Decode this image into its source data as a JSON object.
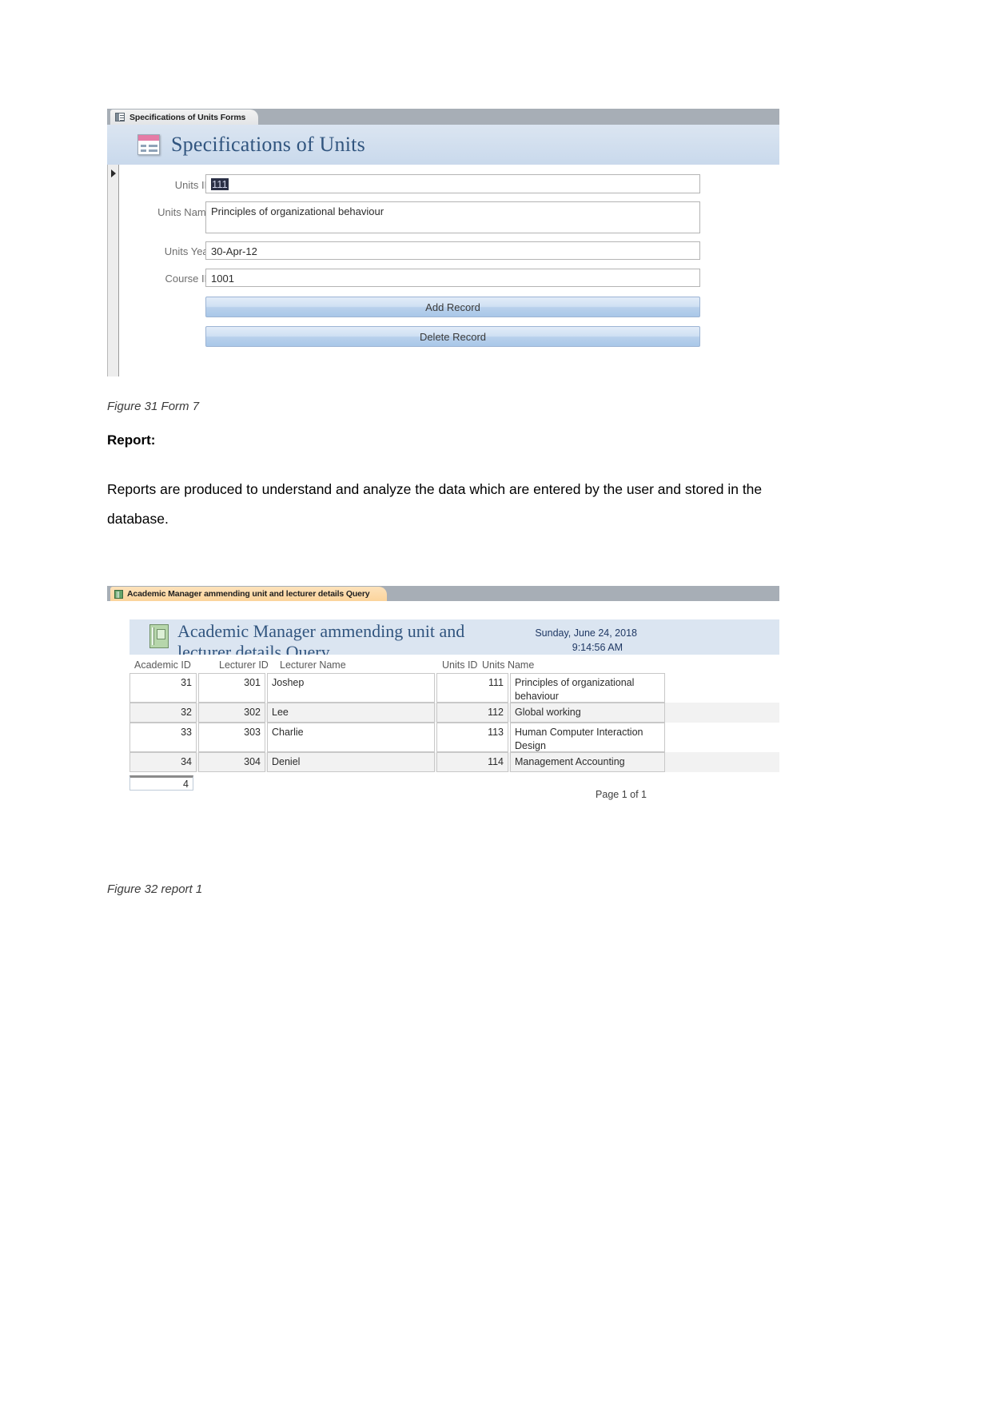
{
  "form_screenshot": {
    "tab": {
      "label": "Specifications of Units Forms",
      "icon": "form-icon"
    },
    "header": {
      "title": "Specifications of Units",
      "icon": "form-design-icon"
    },
    "fields": [
      {
        "label": "Units ID",
        "value": "111",
        "selected": true
      },
      {
        "label": "Units Name",
        "value": "Principles of organizational behaviour",
        "selected": false
      },
      {
        "label": "Units Year",
        "value": "30-Apr-12",
        "selected": false
      },
      {
        "label": "Course ID",
        "value": "1001",
        "selected": false
      }
    ],
    "buttons": [
      {
        "label": "Add Record"
      },
      {
        "label": "Delete Record"
      }
    ],
    "record_selector_icon": "record-selector-arrow-icon"
  },
  "figure_31_caption": "Figure 31 Form 7",
  "report_heading": "Report:",
  "report_paragraph": "Reports are produced to understand and analyze the data which are entered by the user and stored in the database.",
  "report_screenshot": {
    "tab": {
      "label": "Academic Manager ammending unit and lecturer details Query",
      "icon": "report-icon"
    },
    "header": {
      "title": "Academic Manager ammending unit and lecturer details Query",
      "date": "Sunday, June 24, 2018",
      "time": "9:14:56 AM",
      "icon": "report-book-icon"
    },
    "columns": [
      "Academic ID",
      "Lecturer ID",
      "Lecturer Name",
      "Units ID",
      "Units Name"
    ],
    "rows": [
      {
        "academic_id": "31",
        "lecturer_id": "301",
        "lecturer_name": "Joshep",
        "units_id": "111",
        "units_name": "Principles of organizational behaviour"
      },
      {
        "academic_id": "32",
        "lecturer_id": "302",
        "lecturer_name": "Lee",
        "units_id": "112",
        "units_name": "Global working"
      },
      {
        "academic_id": "33",
        "lecturer_id": "303",
        "lecturer_name": "Charlie",
        "units_id": "113",
        "units_name": "Human Computer Interaction Design"
      },
      {
        "academic_id": "34",
        "lecturer_id": "304",
        "lecturer_name": "Deniel",
        "units_id": "114",
        "units_name": "Management Accounting"
      }
    ],
    "record_count": "4",
    "page_label": "Page 1 of 1"
  },
  "figure_32_caption": "Figure 32 report 1",
  "colors": {
    "tab_bar": "#a7aeb6",
    "form_header": "#dbe5f1",
    "form_title_text": "#31557f",
    "report_tab": "#fbd49c",
    "button_fill": "#b9d1ec",
    "alt_row": "#f2f2f2"
  }
}
